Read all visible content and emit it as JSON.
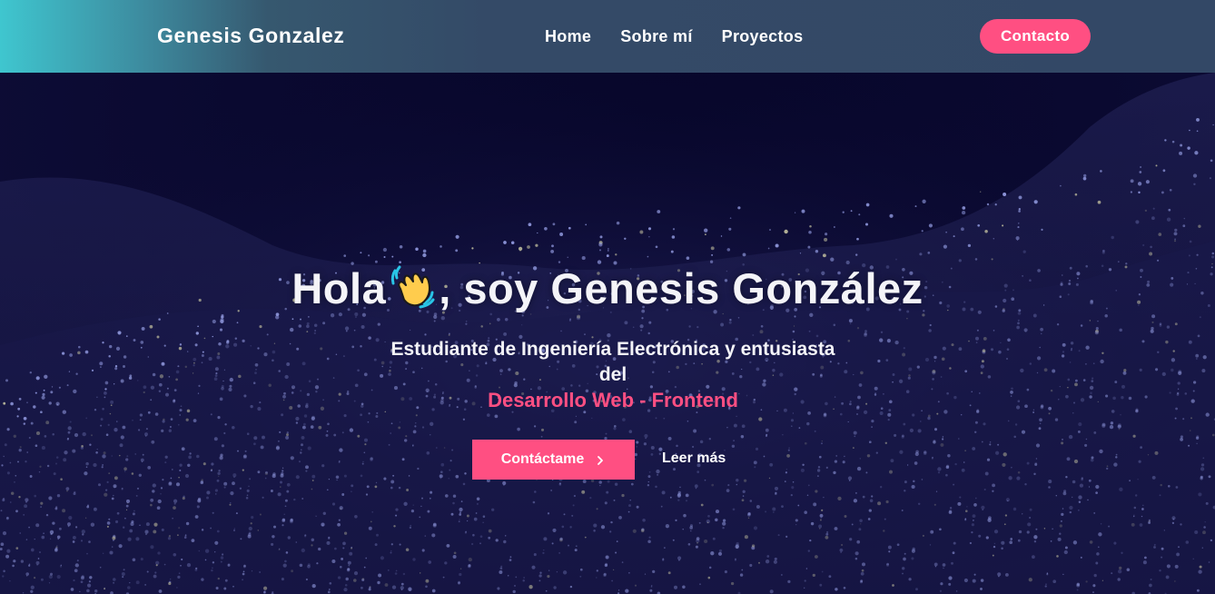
{
  "header": {
    "brand": "Genesis Gonzalez",
    "nav": [
      {
        "label": "Home"
      },
      {
        "label": "Sobre mí"
      },
      {
        "label": "Proyectos"
      }
    ],
    "cta_label": "Contacto"
  },
  "hero": {
    "title_before": "Hola",
    "title_icon": "waving-hand-icon",
    "title_after": ", soy Genesis González",
    "subtitle_line1": "Estudiante de Ingeniería Electrónica y entusiasta",
    "subtitle_line2": "del",
    "subtitle_accent": "Desarrollo Web - Frontend",
    "primary_button": "Contáctame",
    "primary_button_icon": "chevron-right-icon",
    "secondary_button": "Leer más"
  },
  "colors": {
    "accent": "#ff4f82",
    "header_start": "#3fc6cf",
    "header_end": "#334866",
    "hero_background": "#0d0b2a",
    "particles": "#8a92d6"
  }
}
